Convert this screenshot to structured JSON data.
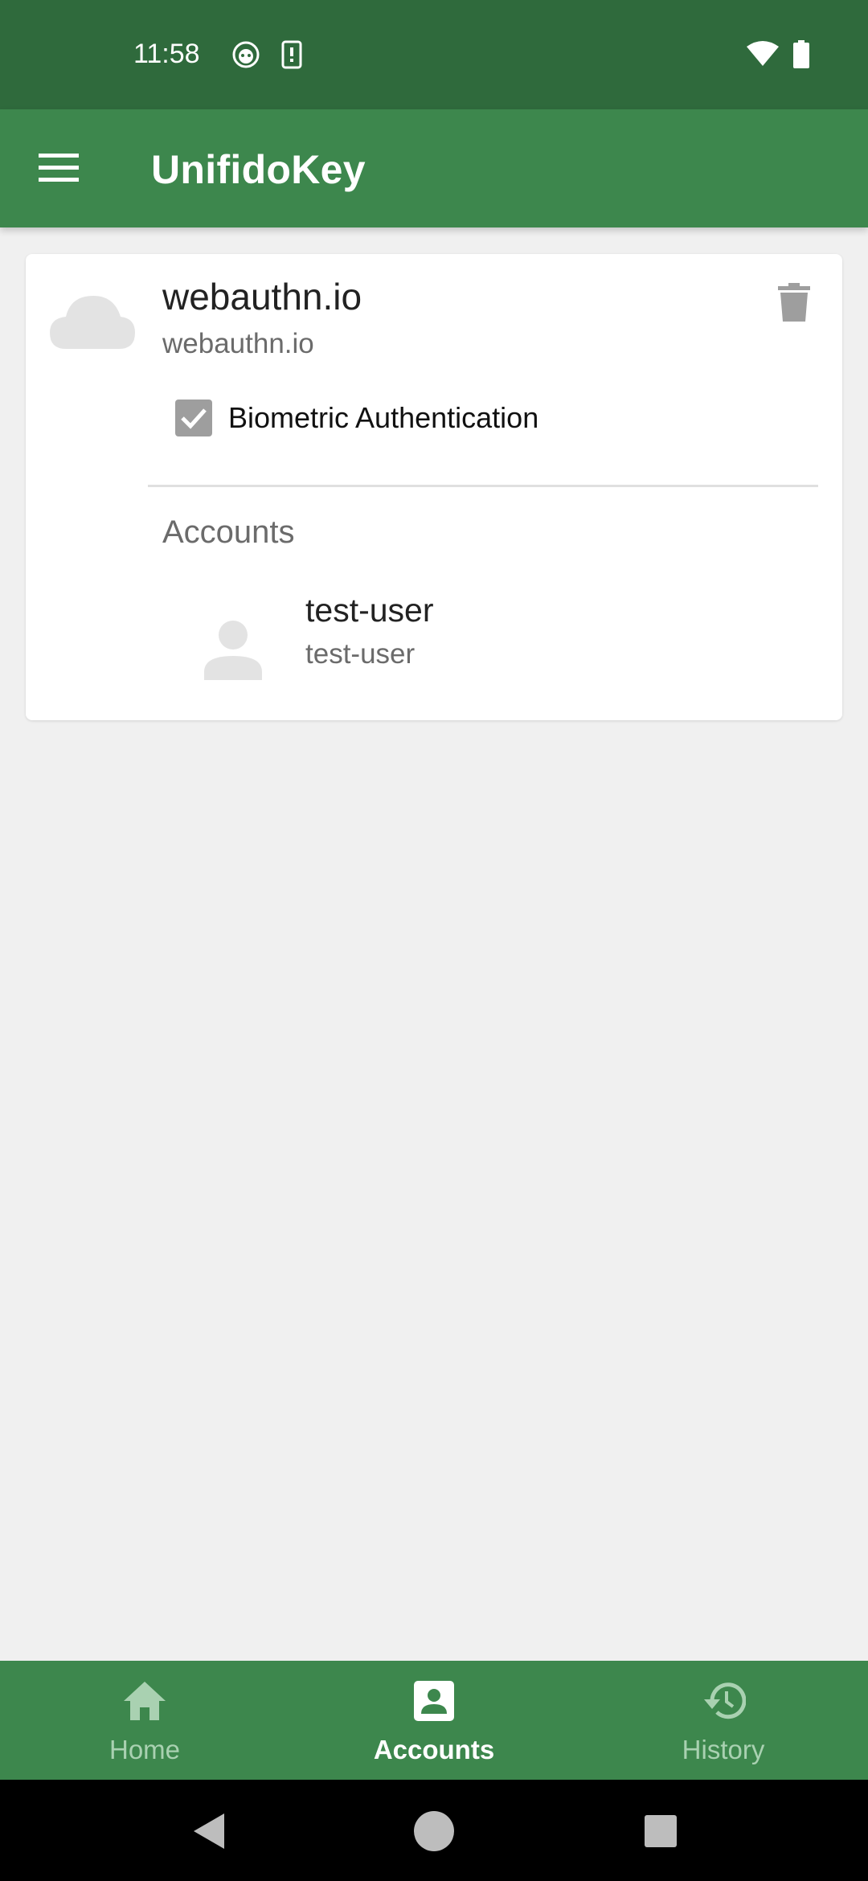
{
  "status_bar": {
    "time": "11:58",
    "icons": [
      "cat-face-icon",
      "phone-alert-icon",
      "wifi-icon",
      "battery-icon"
    ]
  },
  "app_bar": {
    "title": "UnifidoKey",
    "menu_icon": "hamburger-menu-icon"
  },
  "card": {
    "rp_icon": "cloud-icon",
    "rp_name": "webauthn.io",
    "rp_id": "webauthn.io",
    "delete_icon": "trash-icon",
    "biometric": {
      "label": "Biometric Authentication",
      "checked": true
    },
    "accounts_header": "Accounts",
    "accounts": [
      {
        "name": "test-user",
        "display_name": "test-user",
        "icon": "person-icon"
      }
    ]
  },
  "bottom_nav": {
    "items": [
      {
        "label": "Home",
        "icon": "home-icon",
        "active": false
      },
      {
        "label": "Accounts",
        "icon": "account-box-icon",
        "active": true
      },
      {
        "label": "History",
        "icon": "history-icon",
        "active": false
      }
    ]
  },
  "system_nav": [
    "back-icon",
    "home-circle-icon",
    "recents-icon"
  ],
  "colors": {
    "status_bar": "#2f6a3c",
    "primary": "#3d874d",
    "background": "#f0f0f0",
    "nav_inactive": "#a9d1b1"
  }
}
